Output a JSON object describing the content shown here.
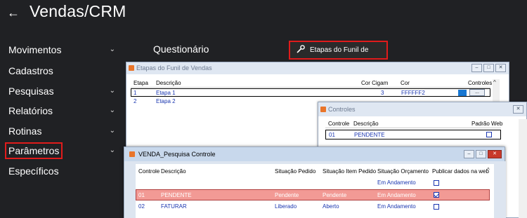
{
  "header": {
    "back_icon": "arrow-left-icon",
    "title": "Vendas/CRM"
  },
  "sidebar": {
    "items": [
      {
        "label": "Movimentos",
        "chevron": true
      },
      {
        "label": "Cadastros",
        "chevron": false
      },
      {
        "label": "Pesquisas",
        "chevron": true
      },
      {
        "label": "Relatórios",
        "chevron": true
      },
      {
        "label": "Rotinas",
        "chevron": true
      },
      {
        "label": "Parâmetros",
        "chevron": true
      },
      {
        "label": "Específicos",
        "chevron": false
      }
    ]
  },
  "menu": {
    "questionario": "Questionário",
    "etapas": "Etapas do Funil de Vendas"
  },
  "etapas_window": {
    "title": "Etapas do Funil de Vendas",
    "columns": [
      "Etapa",
      "Descrição",
      "Cor Cigam",
      "Cor",
      "Controles"
    ],
    "rows": [
      {
        "etapa": "1",
        "descricao": "Etapa 1",
        "cor_cigam": "3",
        "cor": "FFFFFF2",
        "controles": "..."
      },
      {
        "etapa": "2",
        "descricao": "Etapa 2",
        "cor_cigam": "",
        "cor": "",
        "controles": ""
      }
    ],
    "swatch_color": "#1877d2"
  },
  "controles_window": {
    "title": "Controles",
    "columns": [
      "Controle",
      "Descrição",
      "Padrão Web"
    ],
    "rows": [
      {
        "controle": "01",
        "descricao": "PENDENTE",
        "padrao_web": false
      }
    ]
  },
  "pesquisa_window": {
    "title": "VENDA_Pesquisa Controle",
    "columns": [
      "Controle",
      "Descrição",
      "Situação Pedido",
      "Situação Item Pedido",
      "Situação Orçamento",
      "Publicar dados na web"
    ],
    "rows": [
      {
        "controle": "",
        "descricao": "",
        "sit_pedido": "",
        "sit_item": "",
        "sit_orc": "Em Andamento",
        "publicar": false
      },
      {
        "controle": "01",
        "descricao": "PENDENTE",
        "sit_pedido": "Pendente",
        "sit_item": "Pendente",
        "sit_orc": "Em Andamento",
        "publicar": true
      },
      {
        "controle": "02",
        "descricao": "FATURAR",
        "sit_pedido": "Liberado",
        "sit_item": "Aberto",
        "sit_orc": "Em Andamento",
        "publicar": false
      }
    ],
    "selected_row_color": "#f29a95"
  }
}
